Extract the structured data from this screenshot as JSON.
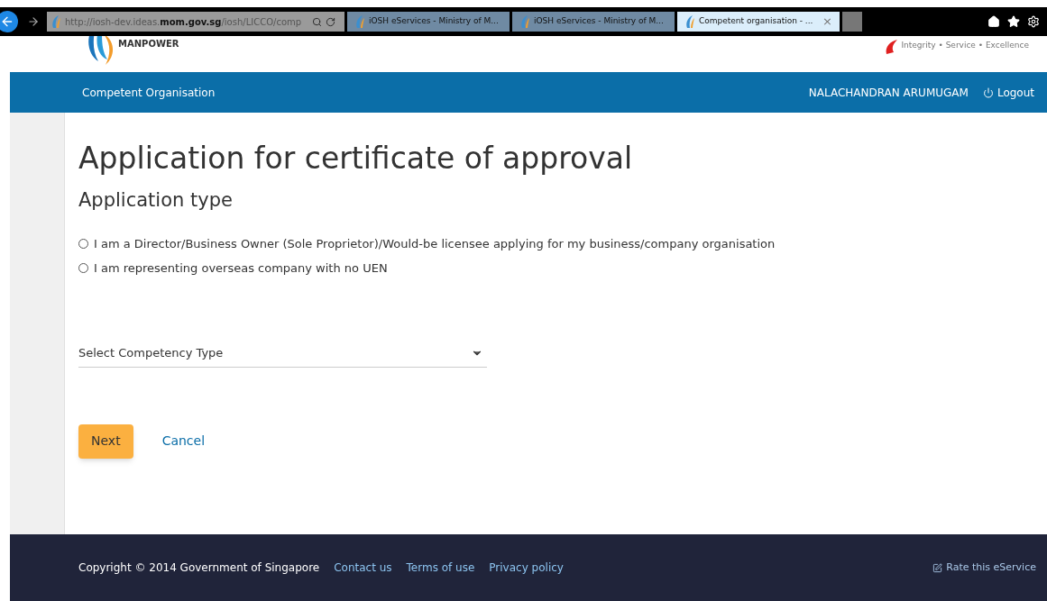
{
  "browser": {
    "address_prefix": "http://iosh-dev.ideas.",
    "address_domain": "mom.gov.sg",
    "address_suffix": "/iosh/LICCO/comp",
    "tabs": [
      {
        "label": "iOSH eServices - Ministry of M...",
        "selected": false
      },
      {
        "label": "iOSH eServices - Ministry of M...",
        "selected": false
      },
      {
        "label": "Competent organisation - ...",
        "selected": true,
        "close": "×"
      }
    ]
  },
  "header": {
    "ministry_logo_text": "MANPOWER",
    "gov_tagline": "Integrity • Service • Excellence"
  },
  "navbar": {
    "title": "Competent Organisation",
    "user": "NALACHANDRAN ARUMUGAM",
    "logout": "Logout"
  },
  "page": {
    "title": "Application for certificate of approval",
    "subtitle": "Application type",
    "options": [
      {
        "label": "I am a Director/Business Owner (Sole Proprietor)/Would-be licensee applying for my business/company organisation",
        "selected": false
      },
      {
        "label": "I am representing overseas company with no UEN",
        "selected": false
      }
    ],
    "select": {
      "placeholder": "Select Competency Type"
    },
    "buttons": {
      "next": "Next",
      "cancel": "Cancel"
    }
  },
  "footer": {
    "copyright": "Copyright © 2014 Government of Singapore",
    "links": [
      "Contact us",
      "Terms of use",
      "Privacy policy"
    ],
    "rate": "Rate this eService"
  }
}
